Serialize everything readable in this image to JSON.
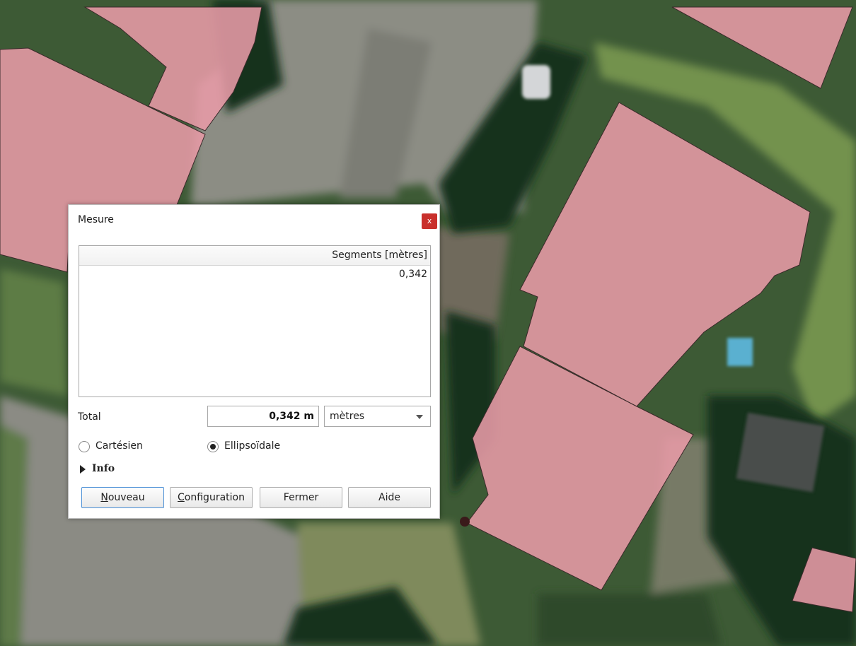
{
  "dialog": {
    "title": "Mesure",
    "close_label": "x",
    "table": {
      "header": "Segments [mètres]",
      "rows": [
        "0,342"
      ]
    },
    "total_label": "Total",
    "total_value": "0,342 m",
    "unit": "mètres",
    "radio": {
      "cartesian": "Cartésien",
      "ellipsoidal": "Ellipsoïdale",
      "selected": "ellipsoidal"
    },
    "info_label": "Info",
    "buttons": {
      "new_first": "N",
      "new_rest": "ouveau",
      "config_first": "C",
      "config_rest": "onfiguration",
      "close": "Fermer",
      "help": "Aide"
    }
  },
  "colors": {
    "building_fill": "#e89ba7",
    "vegetation_dark": "#1c3a22",
    "grass": "#6b8a4c",
    "pavement": "#8e8f86"
  }
}
